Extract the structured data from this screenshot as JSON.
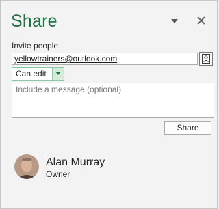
{
  "pane": {
    "title": "Share",
    "accent_color": "#217346",
    "menu_icon": "triangle-down-icon",
    "close_icon": "close-icon"
  },
  "invite": {
    "label": "Invite people",
    "value": "yellowtrainers@outlook.com",
    "address_book_icon": "address-book-icon"
  },
  "permission": {
    "selected": "Can edit"
  },
  "message": {
    "placeholder": "Include a message (optional)"
  },
  "share_button": {
    "label": "Share"
  },
  "owner": {
    "name": "Alan Murray",
    "role": "Owner"
  }
}
